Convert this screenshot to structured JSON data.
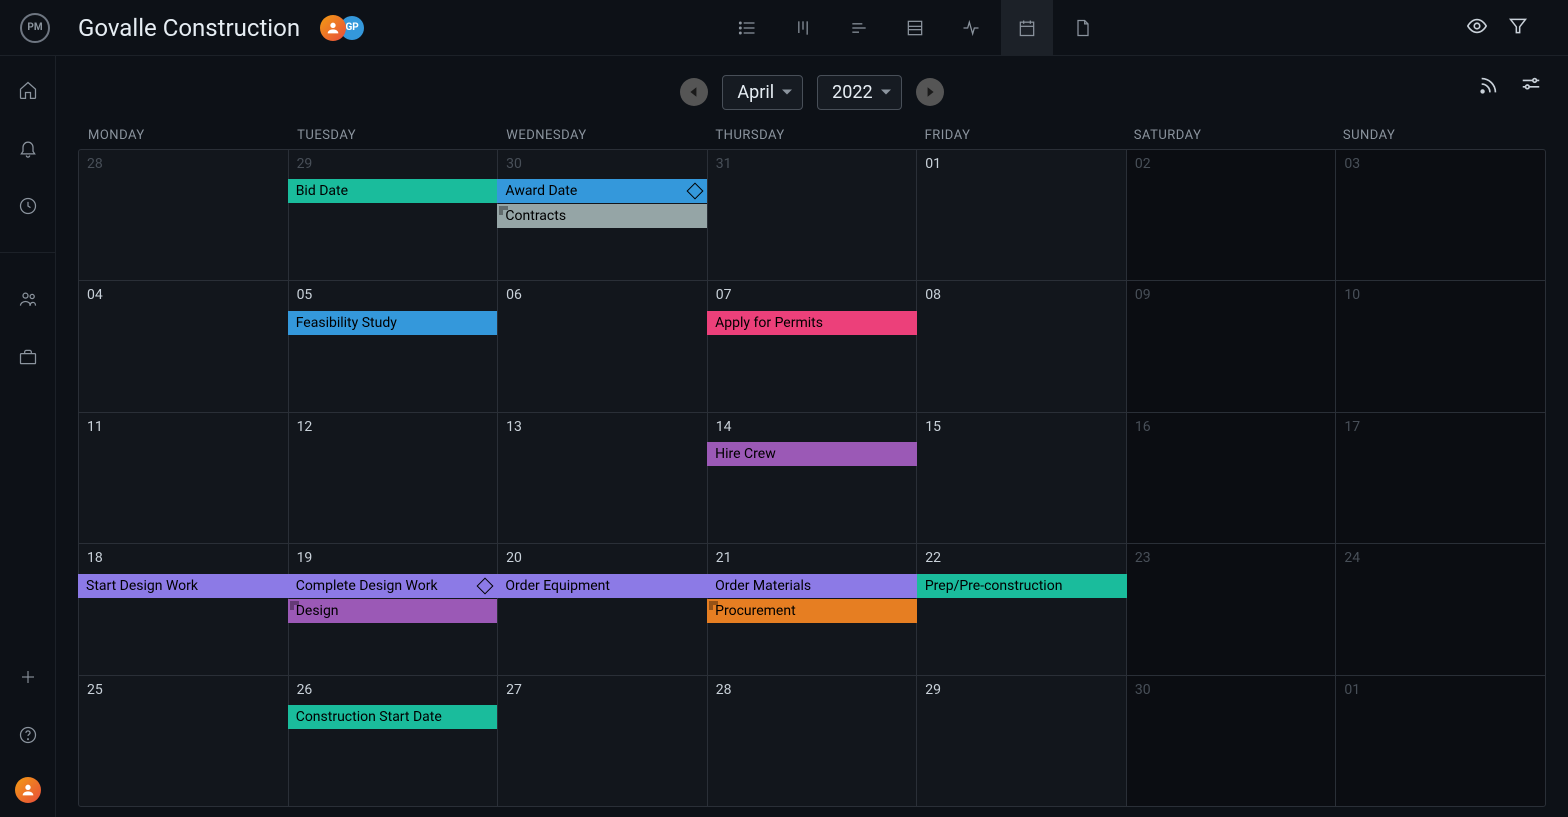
{
  "logo": "PM",
  "project_title": "Govalle Construction",
  "avatar2_initials": "GP",
  "month": "April",
  "year": "2022",
  "day_headers": [
    "MONDAY",
    "TUESDAY",
    "WEDNESDAY",
    "THURSDAY",
    "FRIDAY",
    "SATURDAY",
    "SUNDAY"
  ],
  "colors": {
    "teal": "#1abc9c",
    "blue": "#3498db",
    "gray": "#95a5a6",
    "pink": "#ec407a",
    "purple": "#9b59b6",
    "lavender": "#8c7ae6",
    "orange": "#e67e22"
  },
  "weeks": [
    {
      "days": [
        {
          "num": "28",
          "dim": true
        },
        {
          "num": "29",
          "dim": true
        },
        {
          "num": "30",
          "dim": true
        },
        {
          "num": "31",
          "dim": true
        },
        {
          "num": "01",
          "dim": false
        },
        {
          "num": "02",
          "dim": true,
          "weekend": true
        },
        {
          "num": "03",
          "dim": true,
          "weekend": true
        }
      ],
      "events": [
        {
          "label": "Bid Date",
          "start": 1,
          "span": 1,
          "row": 0,
          "color": "teal"
        },
        {
          "label": "Award Date",
          "start": 2,
          "span": 1,
          "row": 0,
          "color": "blue",
          "milestone": true
        },
        {
          "label": "Contracts",
          "start": 2,
          "span": 1,
          "row": 1,
          "color": "gray",
          "folder": true
        }
      ]
    },
    {
      "days": [
        {
          "num": "04"
        },
        {
          "num": "05"
        },
        {
          "num": "06"
        },
        {
          "num": "07"
        },
        {
          "num": "08"
        },
        {
          "num": "09",
          "dim": true,
          "weekend": true
        },
        {
          "num": "10",
          "dim": true,
          "weekend": true
        }
      ],
      "events": [
        {
          "label": "Feasibility Study",
          "start": 1,
          "span": 1,
          "row": 0,
          "color": "blue"
        },
        {
          "label": "Apply for Permits",
          "start": 3,
          "span": 1,
          "row": 0,
          "color": "pink"
        }
      ]
    },
    {
      "days": [
        {
          "num": "11"
        },
        {
          "num": "12"
        },
        {
          "num": "13"
        },
        {
          "num": "14"
        },
        {
          "num": "15"
        },
        {
          "num": "16",
          "dim": true,
          "weekend": true
        },
        {
          "num": "17",
          "dim": true,
          "weekend": true
        }
      ],
      "events": [
        {
          "label": "Hire Crew",
          "start": 3,
          "span": 1,
          "row": 0,
          "color": "purple"
        }
      ]
    },
    {
      "days": [
        {
          "num": "18"
        },
        {
          "num": "19"
        },
        {
          "num": "20"
        },
        {
          "num": "21"
        },
        {
          "num": "22"
        },
        {
          "num": "23",
          "dim": true,
          "weekend": true
        },
        {
          "num": "24",
          "dim": true,
          "weekend": true
        }
      ],
      "events": [
        {
          "label": "Start Design Work",
          "start": 0,
          "span": 1,
          "row": 0,
          "color": "lavender"
        },
        {
          "label": "Complete Design Work",
          "start": 1,
          "span": 1,
          "row": 0,
          "color": "lavender",
          "milestone": true
        },
        {
          "label": "Order Equipment",
          "start": 2,
          "span": 1,
          "row": 0,
          "color": "lavender"
        },
        {
          "label": "Order Materials",
          "start": 3,
          "span": 1,
          "row": 0,
          "color": "lavender"
        },
        {
          "label": "Prep/Pre-construction",
          "start": 4,
          "span": 1,
          "row": 0,
          "color": "teal"
        },
        {
          "label": "Design",
          "start": 1,
          "span": 1,
          "row": 1,
          "color": "purple",
          "folder": true
        },
        {
          "label": "Procurement",
          "start": 3,
          "span": 1,
          "row": 1,
          "color": "orange",
          "folder": true
        }
      ]
    },
    {
      "days": [
        {
          "num": "25"
        },
        {
          "num": "26"
        },
        {
          "num": "27"
        },
        {
          "num": "28"
        },
        {
          "num": "29"
        },
        {
          "num": "30",
          "dim": true,
          "weekend": true
        },
        {
          "num": "01",
          "dim": true,
          "weekend": true
        }
      ],
      "events": [
        {
          "label": "Construction Start Date",
          "start": 1,
          "span": 1,
          "row": 0,
          "color": "teal"
        }
      ]
    }
  ]
}
